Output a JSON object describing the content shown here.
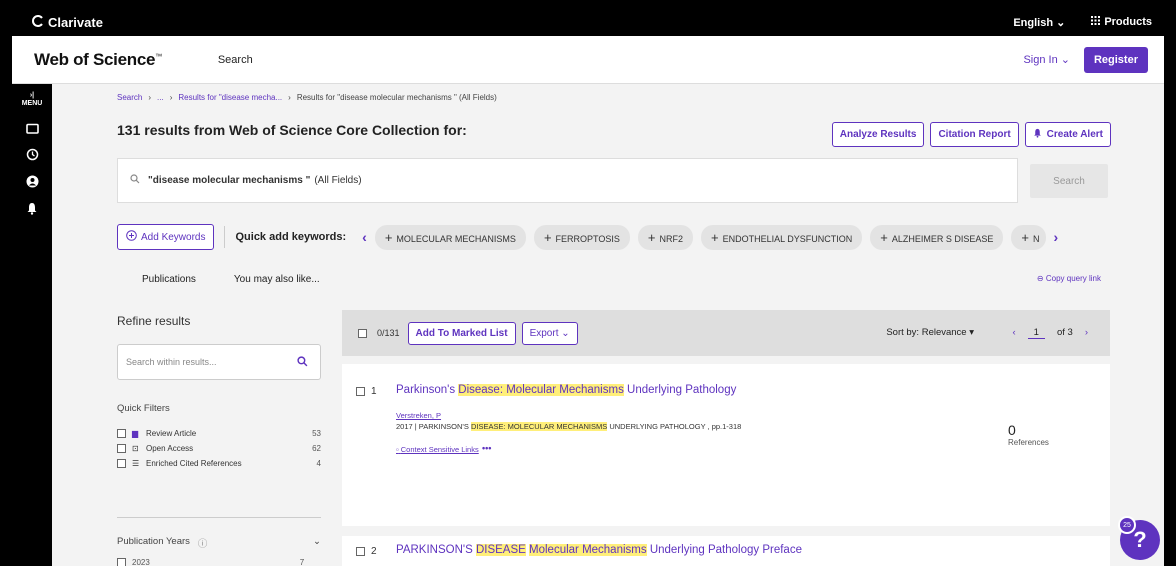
{
  "topbar": {
    "brand": "Clarivate",
    "language": "English ⌄",
    "products": "Products"
  },
  "header": {
    "logo": "Web of Science",
    "tm": "™",
    "nav_search": "Search",
    "sign_in": "Sign In ⌄",
    "register": "Register"
  },
  "rail": {
    "menu_label": "MENU"
  },
  "breadcrumb": {
    "search": "Search",
    "ellipsis": "...",
    "prev": "Results for \"disease mecha...",
    "current": "Results for \"disease molecular mechanisms \" (All Fields)"
  },
  "results": {
    "title": "131 results from Web of Science Core Collection for:",
    "analyze": "Analyze Results",
    "citation": "Citation Report",
    "alert": "Create Alert",
    "query": "\"disease molecular mechanisms \"",
    "query_field": "(All Fields)",
    "search_btn": "Search"
  },
  "keywords": {
    "add_label": "Add Keywords",
    "quick_label": "Quick add keywords:",
    "chips": [
      "MOLECULAR MECHANISMS",
      "FERROPTOSIS",
      "NRF2",
      "ENDOTHELIAL DYSFUNCTION",
      "ALZHEIMER S DISEASE",
      "N"
    ]
  },
  "tabs": {
    "publications": "Publications",
    "also_like": "You may also like...",
    "copy_link": "Copy query link"
  },
  "refine": {
    "title": "Refine results",
    "search_placeholder": "Search within results...",
    "quick_filters": "Quick Filters",
    "filters": [
      {
        "label": "Review Article",
        "count": "53"
      },
      {
        "label": "Open Access",
        "count": "62"
      },
      {
        "label": "Enriched Cited References",
        "count": "4"
      }
    ],
    "pub_years": "Publication Years",
    "year_first": "2023",
    "year_first_count": "7"
  },
  "toolbar": {
    "selected": "0/131",
    "add_marked": "Add To Marked List",
    "export": "Export ⌄",
    "sort": "Sort by: Relevance ▾",
    "page": "1",
    "of": "of 3"
  },
  "record1": {
    "num": "1",
    "title_a": "Parkinson's ",
    "title_hl1": "Disease: Molecular Mechanisms",
    "title_b": " Underlying Pathology",
    "author": "Verstreken, P",
    "src_a": "2017 | PARKINSON'S ",
    "src_hl": "DISEASE: MOLECULAR MECHANISMS",
    "src_b": " UNDERLYING PATHOLOGY , pp.1-318",
    "context": "Context Sensitive Links",
    "more": "•••",
    "refs_count": "0",
    "refs_label": "References"
  },
  "record2": {
    "num": "2",
    "title_a": "PARKINSON'S ",
    "title_hl1": "DISEASE",
    "title_mid": " ",
    "title_hl2": "Molecular Mechanisms",
    "title_b": " Underlying Pathology Preface"
  },
  "help": {
    "badge": "25",
    "symbol": "?"
  }
}
